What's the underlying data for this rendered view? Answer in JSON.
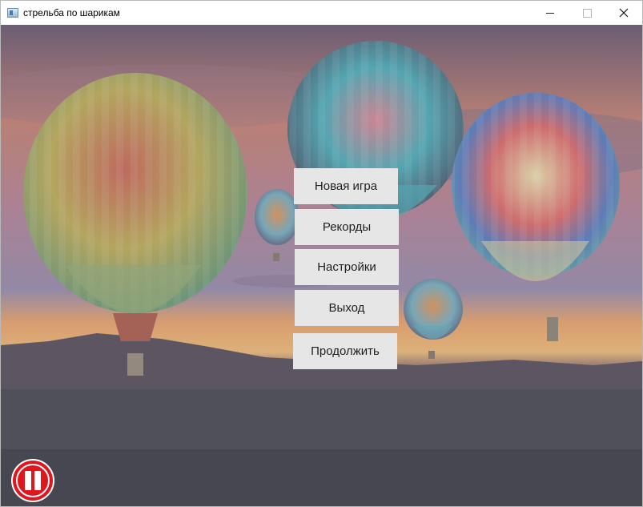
{
  "window": {
    "title": "стрельба по шарикам",
    "controls": {
      "minimize_glyph": "—",
      "maximize_glyph": "☐",
      "close_glyph": "✕"
    }
  },
  "menu": {
    "new_game": "Новая игра",
    "records": "Рекорды",
    "settings": "Настройки",
    "exit": "Выход",
    "continue": "Продолжить"
  },
  "pause": {
    "icon": "pause-icon",
    "color": "#e0161e"
  },
  "background": {
    "scene": "hot air balloons at sunset",
    "colors": [
      "#f2a57a",
      "#7a6e8d",
      "#4e4f5f"
    ]
  }
}
